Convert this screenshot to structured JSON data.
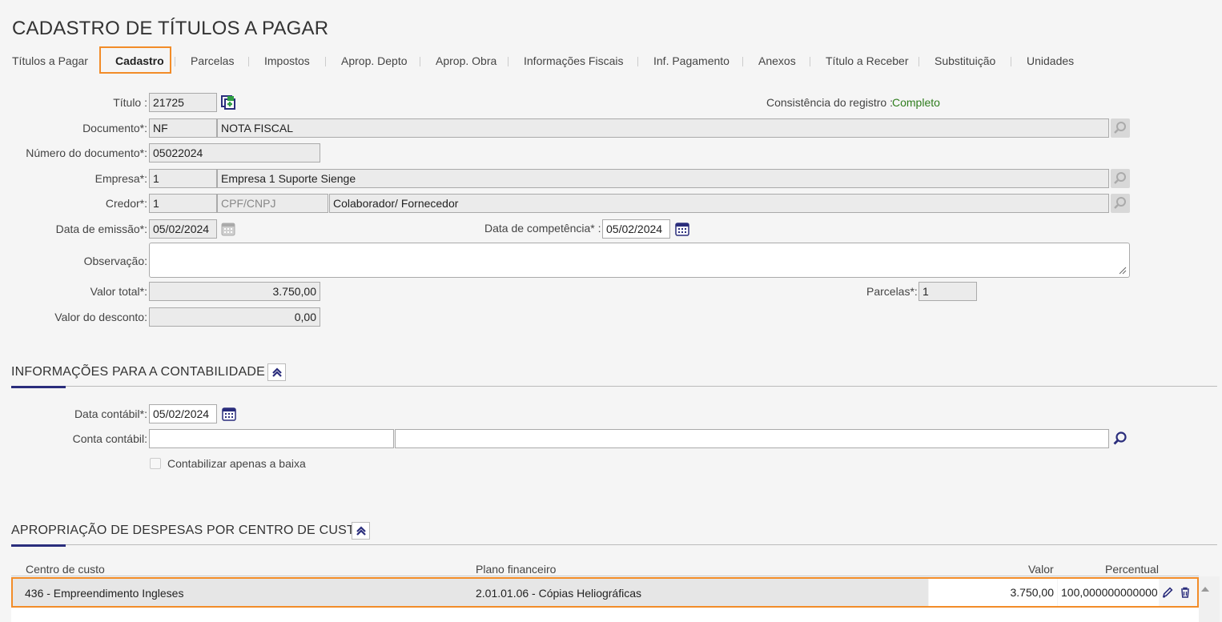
{
  "page": {
    "title": "CADASTRO DE TÍTULOS A PAGAR"
  },
  "tabs": [
    {
      "label": "Títulos a Pagar"
    },
    {
      "label": "Cadastro"
    },
    {
      "label": "Parcelas"
    },
    {
      "label": "Impostos"
    },
    {
      "label": "Aprop. Depto"
    },
    {
      "label": "Aprop. Obra"
    },
    {
      "label": "Informações Fiscais"
    },
    {
      "label": "Inf. Pagamento"
    },
    {
      "label": "Anexos"
    },
    {
      "label": "Título a Receber"
    },
    {
      "label": "Substituição"
    },
    {
      "label": "Unidades"
    }
  ],
  "active_tab": "Cadastro",
  "form": {
    "titulo": {
      "label": "Título :",
      "value": "21725"
    },
    "consistencia": {
      "label": "Consistência do registro :",
      "value": "Completo"
    },
    "documento": {
      "label": "Documento*:",
      "code": "NF",
      "name": "NOTA FISCAL"
    },
    "numero_documento": {
      "label": "Número do documento*:",
      "value": "05022024"
    },
    "empresa": {
      "label": "Empresa*:",
      "code": "1",
      "name": "Empresa 1 Suporte Sienge"
    },
    "credor": {
      "label": "Credor*:",
      "code": "1",
      "doc_placeholder": "CPF/CNPJ",
      "name": "Colaborador/ Fornecedor"
    },
    "data_emissao": {
      "label": "Data de emissão*:",
      "value": "05/02/2024"
    },
    "data_competencia": {
      "label": "Data de competência* :",
      "value": "05/02/2024"
    },
    "observacao": {
      "label": "Observação:",
      "value": ""
    },
    "valor_total": {
      "label": "Valor total*:",
      "value": "3.750,00"
    },
    "parcelas": {
      "label": "Parcelas*:",
      "value": "1"
    },
    "valor_desconto": {
      "label": "Valor do desconto:",
      "value": "0,00"
    }
  },
  "contabilidade": {
    "title": "INFORMAÇÕES PARA A CONTABILIDADE",
    "data_contabil": {
      "label": "Data contábil*:",
      "value": "05/02/2024"
    },
    "conta_contabil": {
      "label": "Conta contábil:",
      "code": "",
      "name": ""
    },
    "contabilizar_baixa": {
      "label": "Contabilizar apenas a baixa",
      "checked": false
    }
  },
  "apropriacao": {
    "title": "APROPRIAÇÃO DE DESPESAS POR CENTRO DE CUSTO",
    "columns": [
      "Centro de custo",
      "Plano financeiro",
      "Valor",
      "Percentual"
    ],
    "rows": [
      {
        "centro_custo": "436 - Empreendimento Ingleses",
        "plano_financeiro": "2.01.01.06 - Cópias Heliográficas",
        "valor": "3.750,00",
        "percentual": "100,000000000000"
      }
    ]
  },
  "colors": {
    "accent_orange": "#f28c28",
    "navy": "#2a2d7c",
    "status_green": "#2f7d1e"
  },
  "icons": [
    "copy-icon",
    "search-icon",
    "calendar-icon",
    "chevron-up-double-icon",
    "edit-pencil-icon",
    "trash-icon"
  ]
}
